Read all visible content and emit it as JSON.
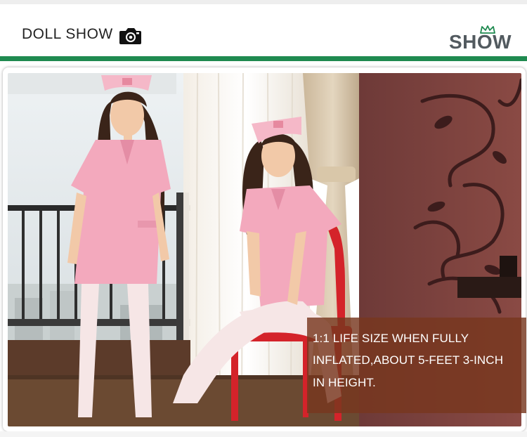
{
  "header": {
    "title": "DOLL SHOW",
    "camera_icon": "camera-icon",
    "brand_logo": "SHOW"
  },
  "colors": {
    "accent_bar": "#1f8a50",
    "caption_background": "#78371e",
    "logo_text": "#525a5f"
  },
  "caption": {
    "lines": [
      "1:1 LIFE SIZE WHEN FULLY",
      "INFLATED,ABOUT 5-FEET 3-INCH",
      "IN HEIGHT."
    ]
  }
}
